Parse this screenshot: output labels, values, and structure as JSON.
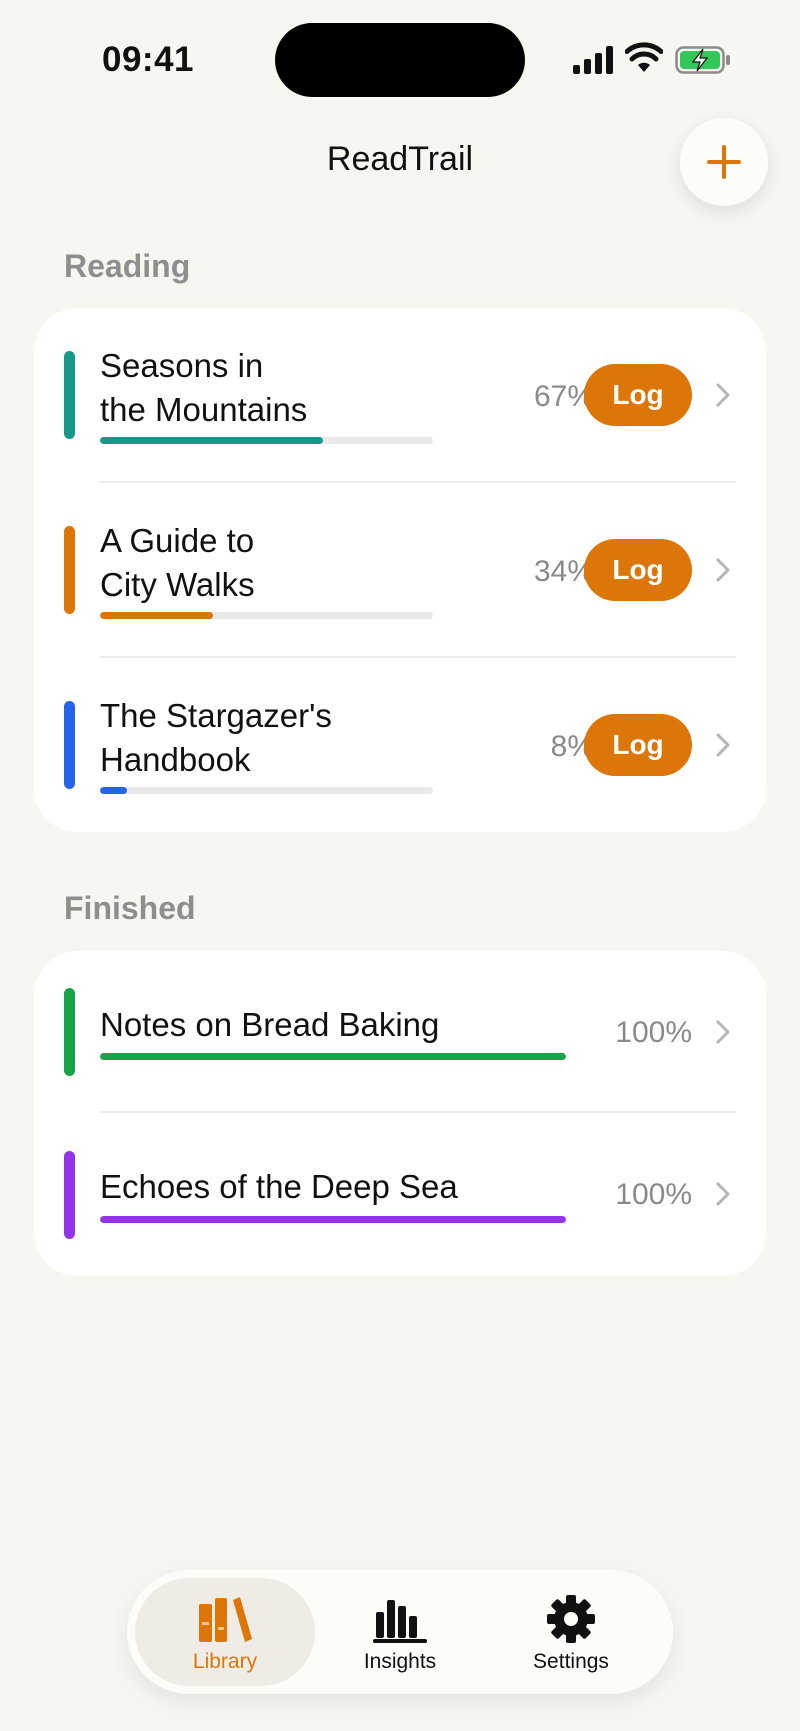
{
  "status_bar": {
    "time": "09:41"
  },
  "header": {
    "title": "ReadTrail",
    "add_icon": "plus-icon"
  },
  "colors": {
    "accent": "#dc7609",
    "background": "#f8f6f1",
    "teal": "#16998a",
    "orange": "#dc7609",
    "blue": "#2563eb",
    "green": "#16a34a",
    "purple": "#9333ea"
  },
  "reading": {
    "title": "Reading",
    "books": [
      {
        "title_line1": "Seasons in",
        "title_line2": "the Mountains",
        "percent": "67%",
        "progress": 0.67,
        "color": "#16998a",
        "log_label": "Log"
      },
      {
        "title_line1": "A Guide to",
        "title_line2": "City Walks",
        "percent": "34%",
        "progress": 0.34,
        "color": "#dc7609",
        "log_label": "Log"
      },
      {
        "title_line1": "The Stargazer's",
        "title_line2": "Handbook",
        "percent": "8%",
        "progress": 0.08,
        "color": "#2563eb",
        "log_label": "Log"
      }
    ]
  },
  "finished": {
    "title": "Finished",
    "books": [
      {
        "title": "Notes on Bread Baking",
        "percent": "100%",
        "progress": 1.0,
        "color": "#16a34a"
      },
      {
        "title": "Echoes of the Deep Sea",
        "percent": "100%",
        "progress": 1.0,
        "color": "#9333ea"
      }
    ]
  },
  "tabs": [
    {
      "label": "Library",
      "icon": "books-icon",
      "active": true
    },
    {
      "label": "Insights",
      "icon": "bar-chart-icon",
      "active": false
    },
    {
      "label": "Settings",
      "icon": "gear-icon",
      "active": false
    }
  ]
}
